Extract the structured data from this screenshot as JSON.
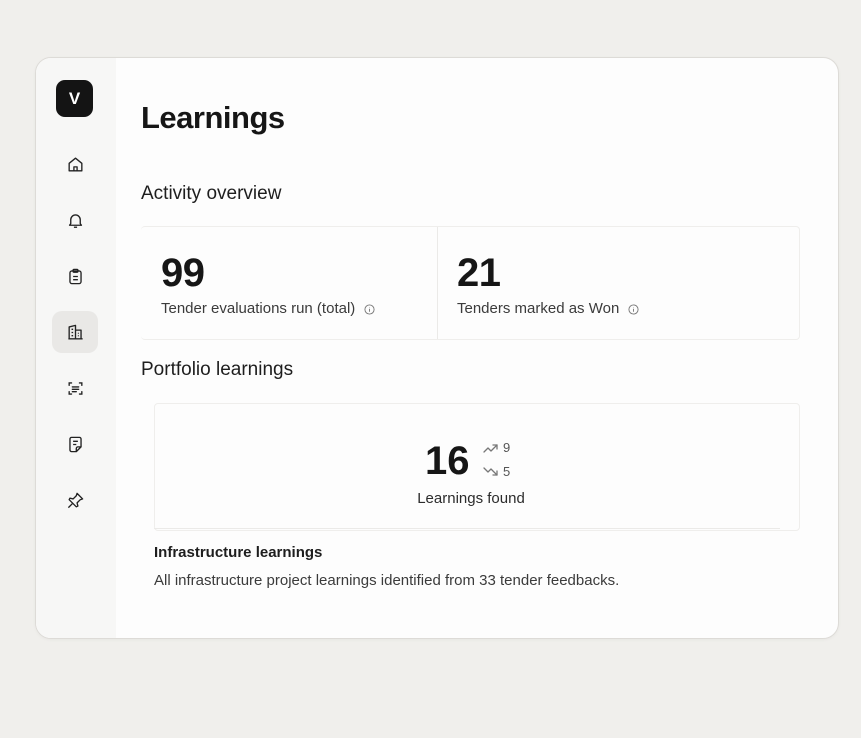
{
  "sidebar": {
    "logo_letter": "V",
    "items": [
      {
        "icon": "home-icon"
      },
      {
        "icon": "bell-icon"
      },
      {
        "icon": "clipboard-icon"
      },
      {
        "icon": "building-icon",
        "active": true
      },
      {
        "icon": "scan-text-icon"
      },
      {
        "icon": "notes-icon"
      },
      {
        "icon": "pin-icon"
      }
    ]
  },
  "page": {
    "title": "Learnings"
  },
  "activity": {
    "heading": "Activity overview",
    "stats": [
      {
        "value": "99",
        "label": "Tender evaluations run (total)"
      },
      {
        "value": "21",
        "label": "Tenders marked as Won"
      }
    ]
  },
  "portfolio": {
    "heading": "Portfolio learnings",
    "count": "16",
    "trend_up": "9",
    "trend_down": "5",
    "count_label": "Learnings found",
    "section_title": "Infrastructure learnings",
    "section_desc": "All infrastructure project learnings identified from 33 tender feedbacks."
  },
  "colors": {
    "page_bg": "#f0efec",
    "logo_bg": "#141414",
    "active_nav_bg": "#e9e8e6"
  }
}
